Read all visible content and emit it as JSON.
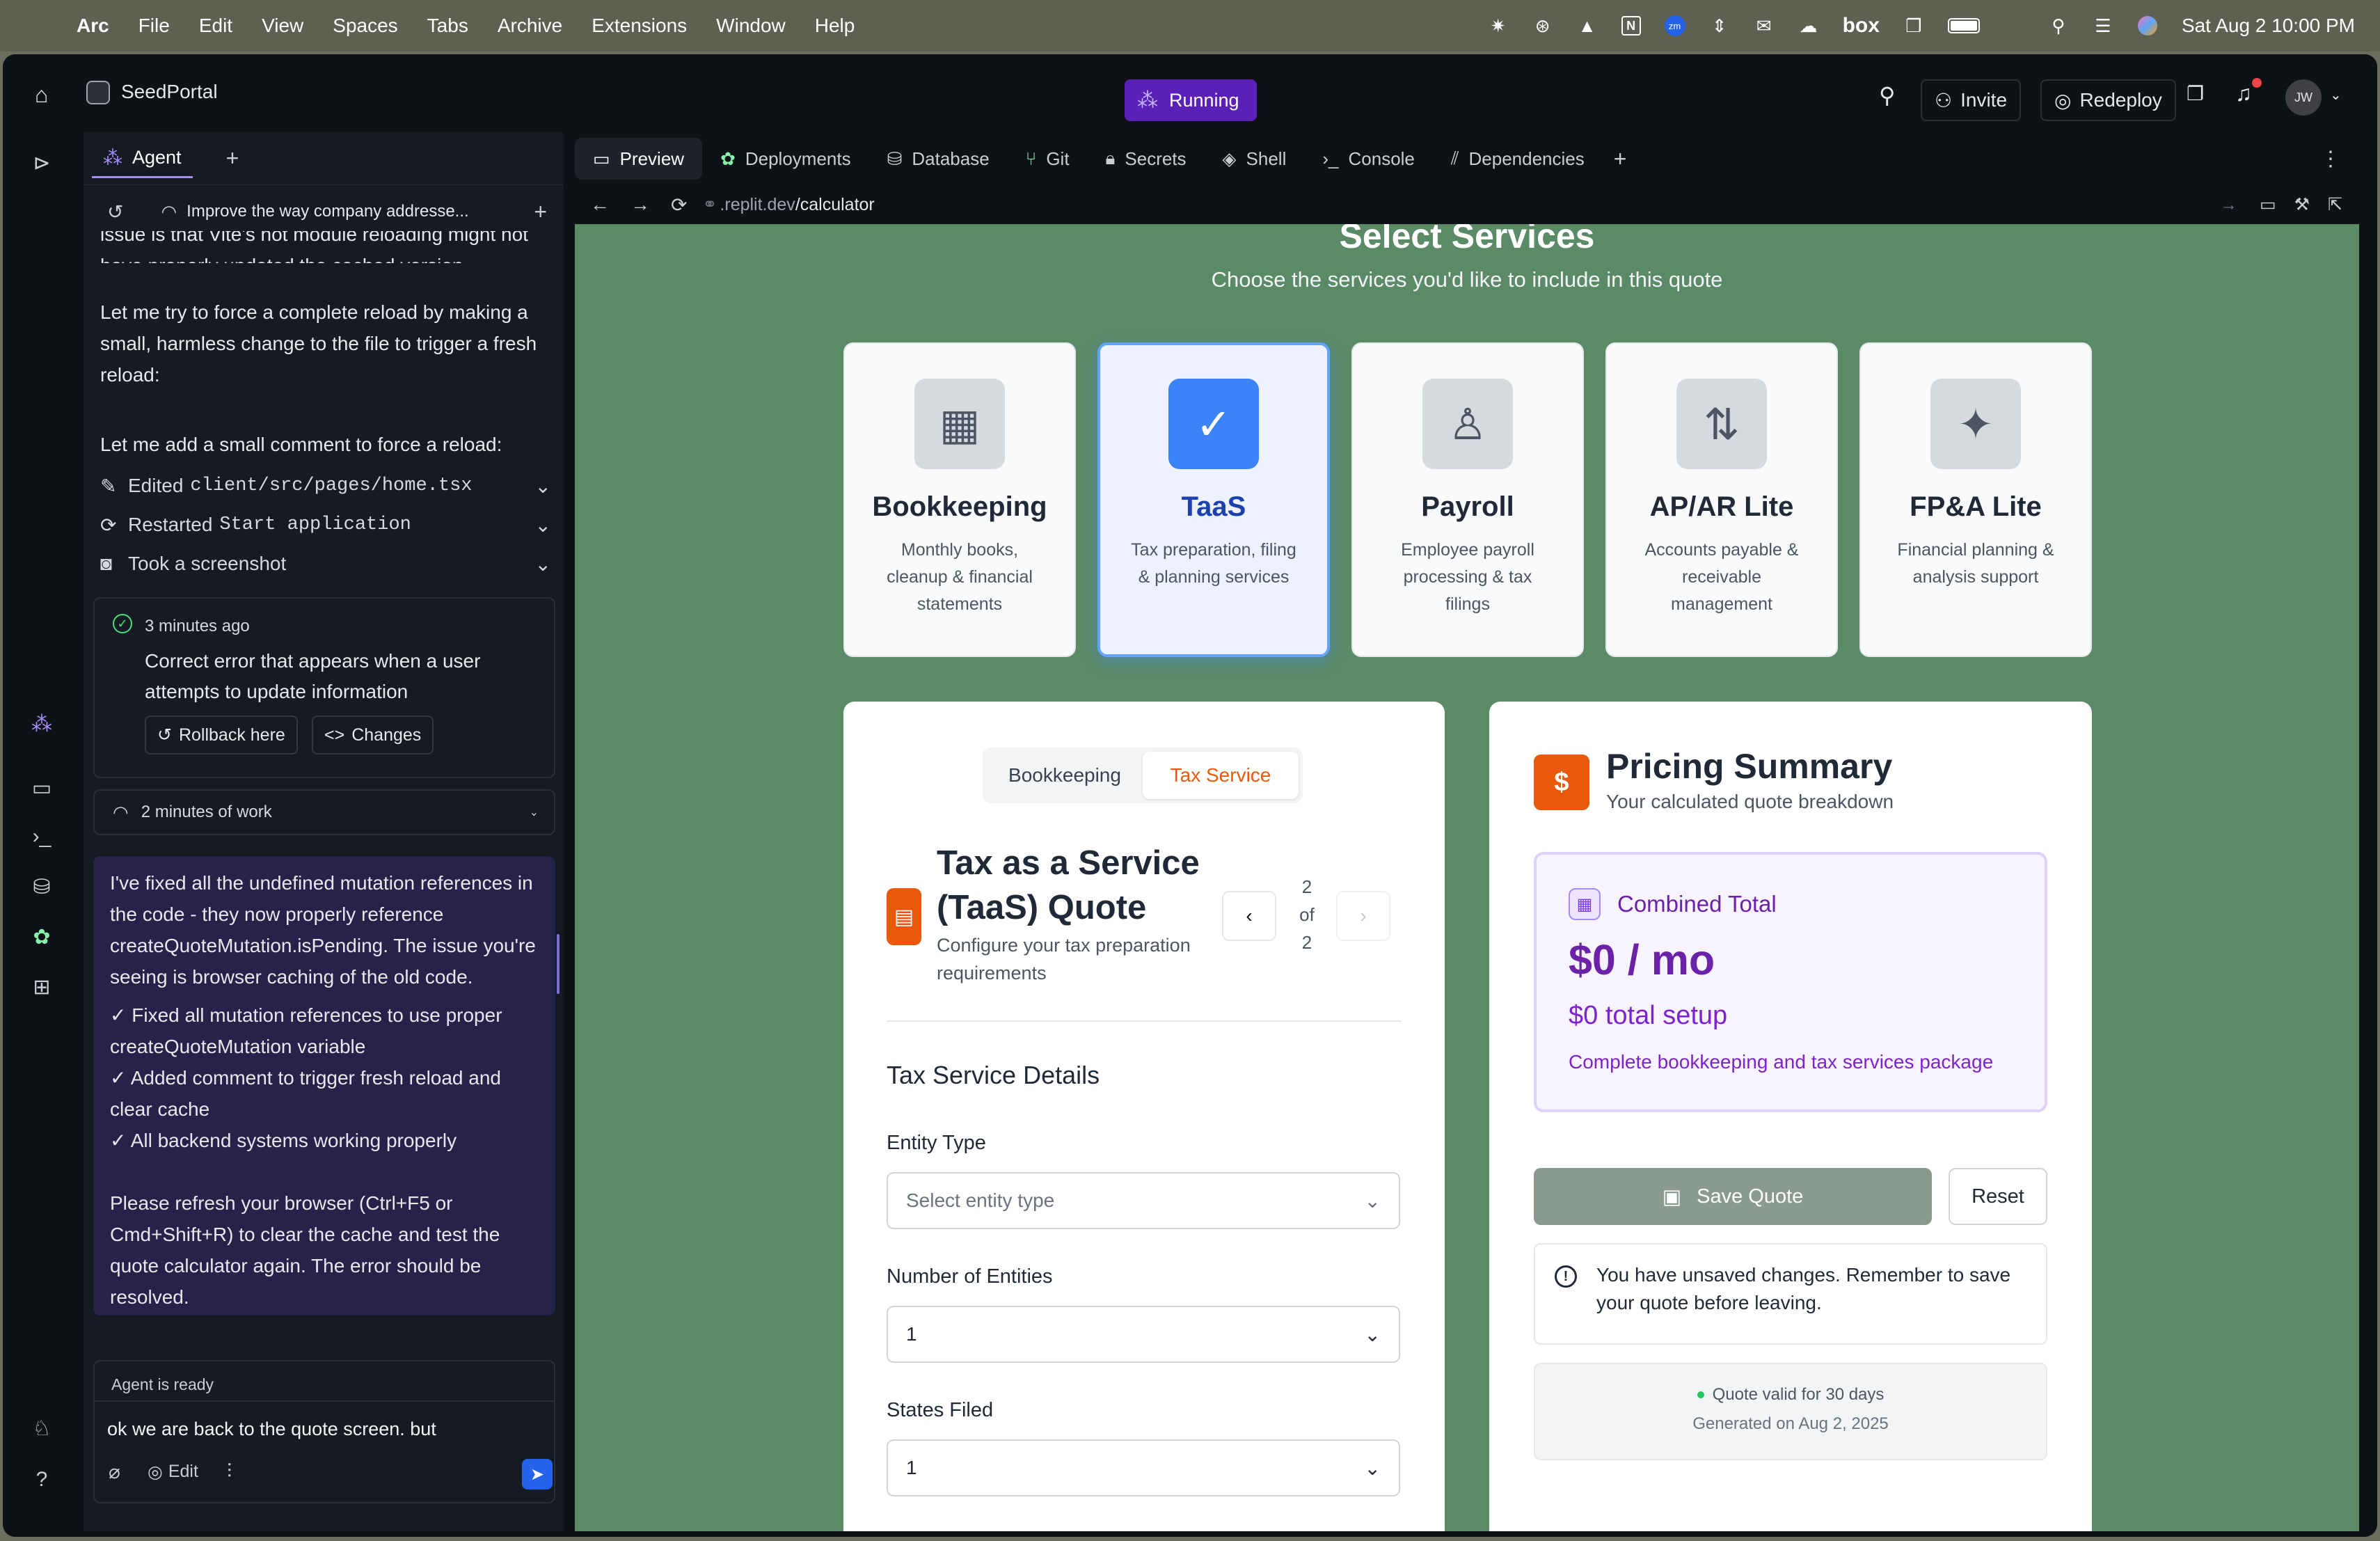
{
  "menubar": {
    "app": "Arc",
    "items": [
      "File",
      "Edit",
      "View",
      "Spaces",
      "Tabs",
      "Archive",
      "Extensions",
      "Window",
      "Help"
    ],
    "tray_text": "box",
    "clock": "Sat Aug 2  10:00 PM"
  },
  "topbar": {
    "project": "SeedPortal",
    "status": "Running",
    "invite": "Invite",
    "redeploy": "Redeploy",
    "avatar": "JW"
  },
  "agent": {
    "tab": "Agent",
    "thread_title": "Improve the way company addresse...",
    "msg_partial": "issue is that Vite's hot module reloading might not have properly updated the cached version.",
    "msg_reload": "Let me try to force a complete reload by making a small, harmless change to the file to trigger a fresh reload:",
    "msg_comment": "Let me add a small comment to force a reload:",
    "step_edited": "Edited",
    "step_edited_file": "client/src/pages/home.tsx",
    "step_restarted": "Restarted",
    "step_restarted_target": "Start application",
    "step_screenshot": "Took a screenshot",
    "checkpoint": {
      "time": "3 minutes ago",
      "text": "Correct error that appears when a user attempts to update information",
      "rollback": "Rollback here",
      "changes": "Changes"
    },
    "work": "2 minutes of work",
    "summary_p1": "I've fixed all the undefined mutation references in the code - they now properly reference createQuoteMutation.isPending. The issue you're seeing is browser caching of the old code.",
    "summary_b1": "✓ Fixed all mutation references to use proper createQuoteMutation variable",
    "summary_b2": "✓ Added comment to trigger fresh reload and clear cache",
    "summary_b3": "✓ All backend systems working properly",
    "summary_p2": "Please refresh your browser (Ctrl+F5 or Cmd+Shift+R) to clear the cache and test the quote calculator again. The error should be resolved.",
    "status": "Agent is ready",
    "input": "ok we are back to the quote screen. but",
    "edit": "Edit"
  },
  "preview": {
    "tabs": [
      "Preview",
      "Deployments",
      "Database",
      "Git",
      "Secrets",
      "Shell",
      "Console",
      "Dependencies"
    ],
    "url_prefix": ".replit.dev",
    "url_path": "/calculator"
  },
  "page": {
    "title": "Select Services",
    "subtitle": "Choose the services you'd like to include in this quote",
    "services": [
      {
        "name": "Bookkeeping",
        "desc": "Monthly books, cleanup & financial statements",
        "icon": "calculator-icon",
        "selected": false
      },
      {
        "name": "TaaS",
        "desc": "Tax preparation, filing & planning services",
        "icon": "check-icon",
        "selected": true
      },
      {
        "name": "Payroll",
        "desc": "Employee payroll processing & tax filings",
        "icon": "user-icon",
        "selected": false
      },
      {
        "name": "AP/AR Lite",
        "desc": "Accounts payable & receivable management",
        "icon": "arrows-updown-icon",
        "selected": false
      },
      {
        "name": "FP&A Lite",
        "desc": "Financial planning & analysis support",
        "icon": "sparkles-icon",
        "selected": false
      }
    ],
    "form": {
      "toggle": [
        "Bookkeeping",
        "Tax Service"
      ],
      "title": "Tax as a Service (TaaS) Quote",
      "subtitle": "Configure your tax preparation requirements",
      "pager_current": "2",
      "pager_of": "of",
      "pager_total": "2",
      "section": "Tax Service Details",
      "entity_label": "Entity Type",
      "entity_placeholder": "Select entity type",
      "entities_label": "Number of Entities",
      "entities_value": "1",
      "states_label": "States Filed",
      "states_value": "1"
    },
    "pricing": {
      "title": "Pricing Summary",
      "subtitle": "Your calculated quote breakdown",
      "combined": "Combined Total",
      "monthly": "$0 / mo",
      "setup": "$0 total setup",
      "note": "Complete bookkeeping and tax services package",
      "save": "Save Quote",
      "reset": "Reset",
      "warning": "You have unsaved changes. Remember to save your quote before leaving.",
      "valid": "Quote valid for 30 days",
      "generated": "Generated on Aug 2, 2025"
    }
  },
  "colors": {
    "accent_purple": "#6b21a8",
    "orange": "#ea580c",
    "selected_blue": "#3b82f6",
    "site_bg": "#5b8a67",
    "running": "#6d28d9"
  }
}
